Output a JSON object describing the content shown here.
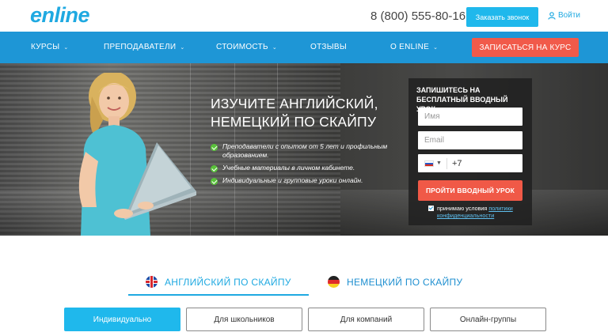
{
  "header": {
    "logo": "enline",
    "phone": "8 (800) 555-80-16",
    "callback_button": "Заказать звонок",
    "login": "Войти"
  },
  "nav": {
    "items": [
      {
        "label": "КУРСЫ",
        "dropdown": true
      },
      {
        "label": "ПРЕПОДАВАТЕЛИ",
        "dropdown": true
      },
      {
        "label": "СТОИМОСТЬ",
        "dropdown": true
      },
      {
        "label": "ОТЗЫВЫ",
        "dropdown": false
      },
      {
        "label": "О ENLINE",
        "dropdown": true
      }
    ],
    "enroll_button": "ЗАПИСАТЬСЯ НА КУРС"
  },
  "hero": {
    "title_line1": "ИЗУЧИТЕ АНГЛИЙСКИЙ,",
    "title_line2": "НЕМЕЦКИЙ ПО СКАЙПУ",
    "features": [
      "Преподаватели с опытом от 5 лет и профильным образованием.",
      "Учебные материалы в личном кабинете.",
      "Индивидуальные и групповые уроки онлайн."
    ]
  },
  "form": {
    "title": "ЗАПИШИТЕСЬ НА БЕСПЛАТНЫЙ ВВОДНЫЙ УРОК",
    "name_placeholder": "Имя",
    "email_placeholder": "Email",
    "phone_code": "+7",
    "submit": "ПРОЙТИ ВВОДНЫЙ УРОК",
    "agree_text": "принимаю условия",
    "agree_link": "политики конфиденциальности"
  },
  "language_tabs": {
    "english": "АНГЛИЙСКИЙ ПО СКАЙПУ",
    "german": "НЕМЕЦКИЙ ПО СКАЙПУ",
    "active": "english"
  },
  "sub_tabs": {
    "items": [
      "Индивидуально",
      "Для школьников",
      "Для компаний",
      "Онлайн-группы"
    ],
    "active_index": 0
  },
  "colors": {
    "brand": "#1fa9e1",
    "nav": "#1e96d6",
    "cta": "#f15a4a",
    "check": "#59c23a"
  }
}
